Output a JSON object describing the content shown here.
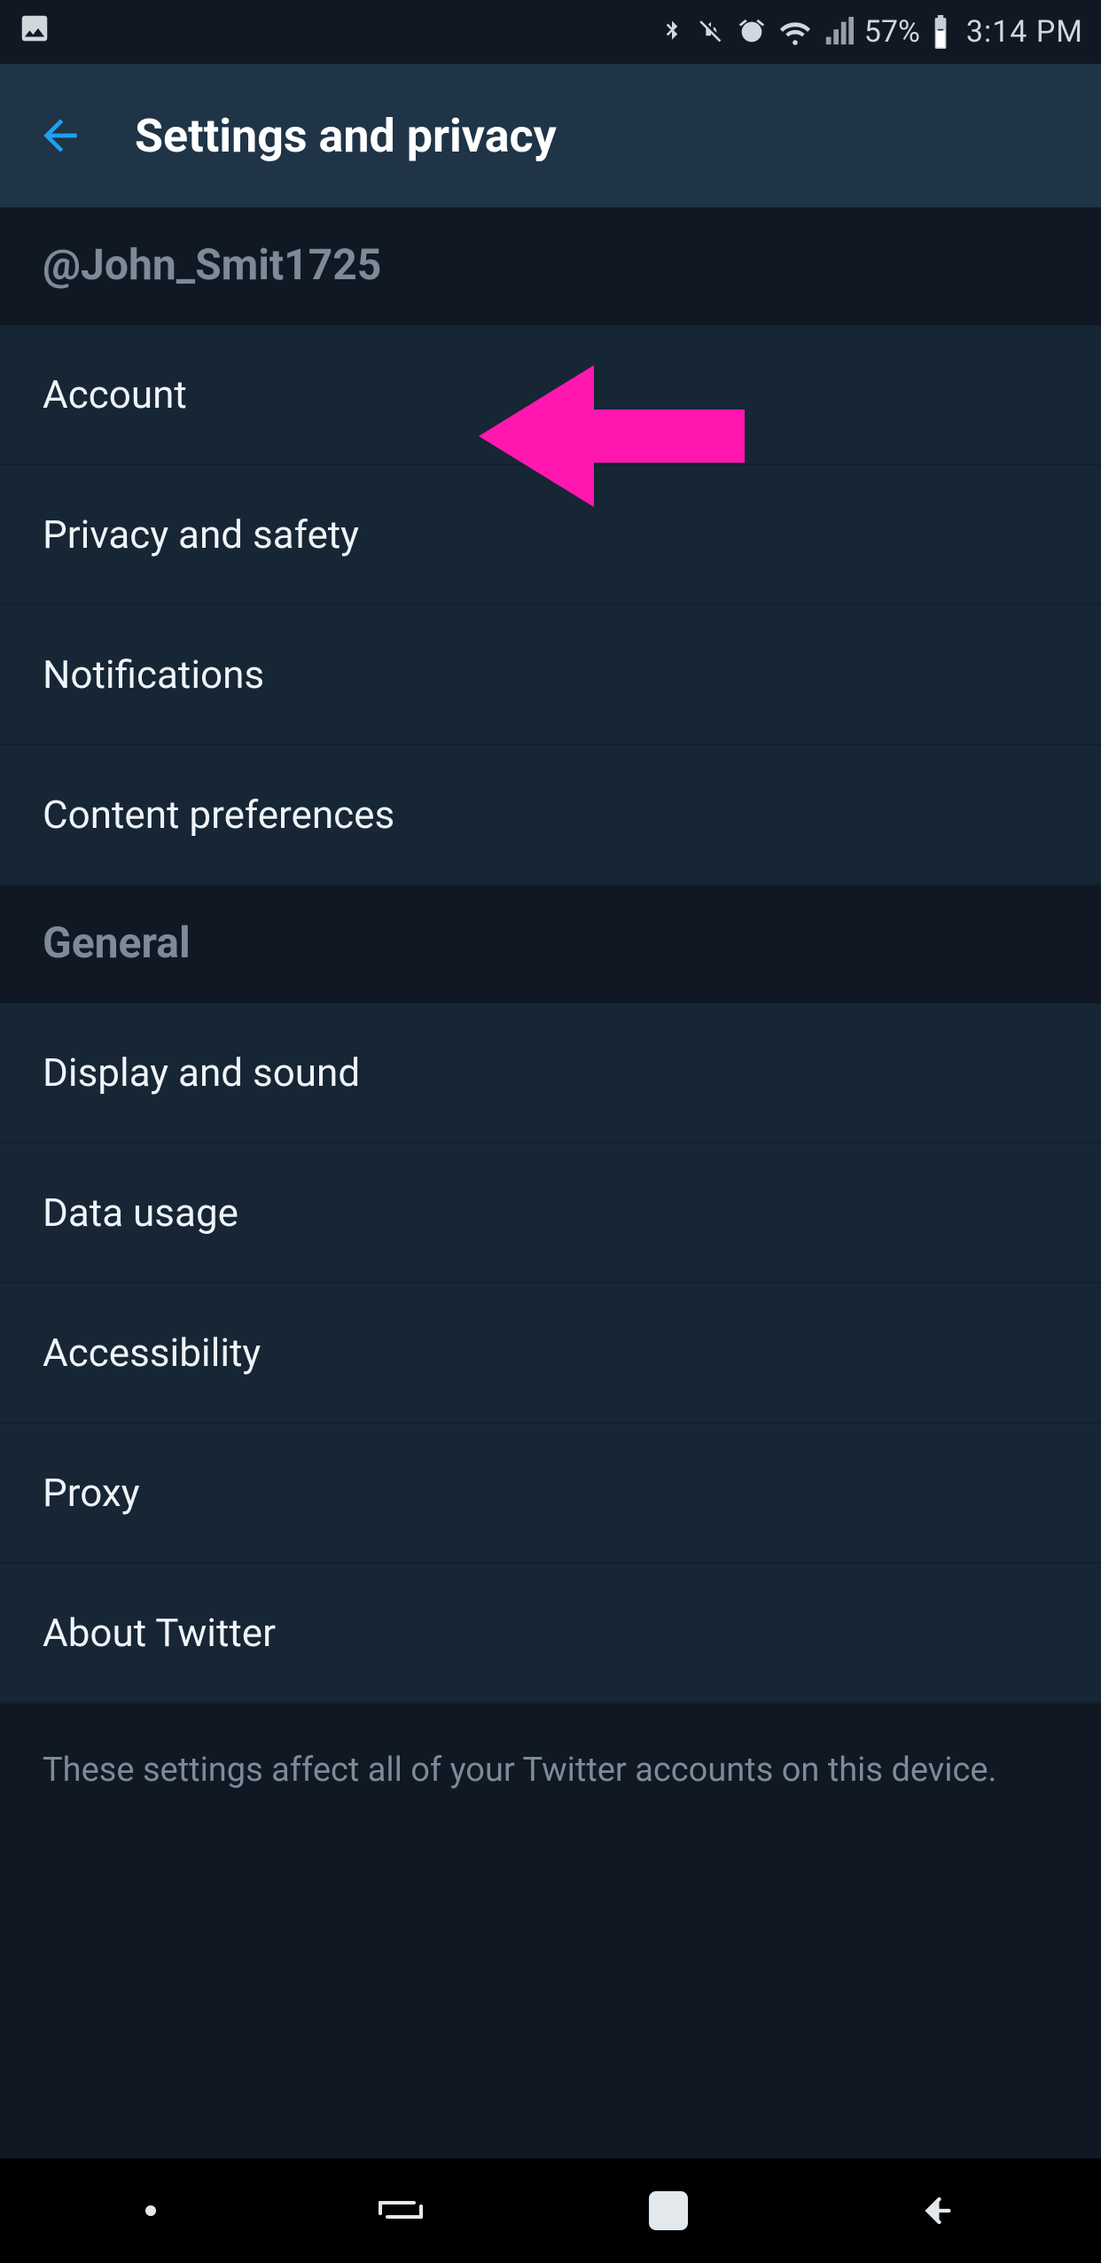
{
  "status": {
    "battery_pct": "57%",
    "time": "3:14 PM"
  },
  "header": {
    "title": "Settings and privacy"
  },
  "sections": {
    "account_handle": "@John_Smit1725",
    "account_items": {
      "account": "Account",
      "privacy_safety": "Privacy and safety",
      "notifications": "Notifications",
      "content_prefs": "Content preferences"
    },
    "general_label": "General",
    "general_items": {
      "display_sound": "Display and sound",
      "data_usage": "Data usage",
      "accessibility": "Accessibility",
      "proxy": "Proxy",
      "about_twitter": "About Twitter"
    }
  },
  "footer_note": "These settings affect all of your Twitter accounts on this device."
}
